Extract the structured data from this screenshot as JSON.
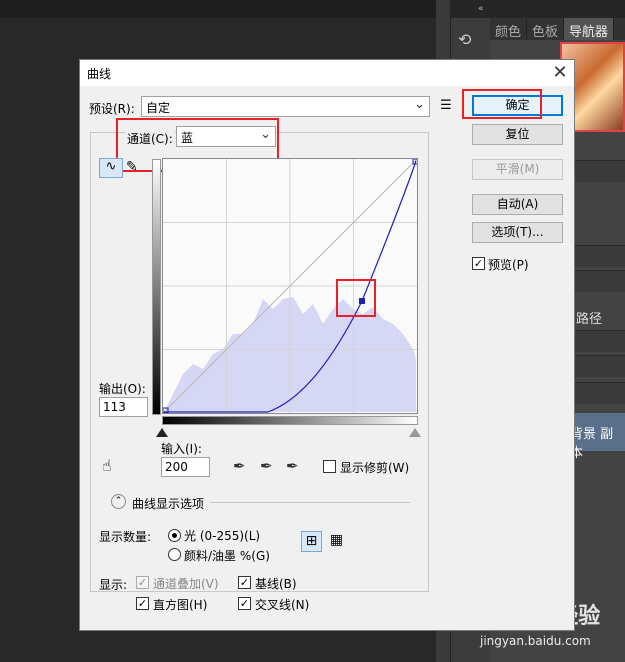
{
  "background_panels": {
    "tabs": [
      "颜色",
      "色板",
      "导航器"
    ],
    "paths_label": "路径",
    "layer_name": "背景 副本",
    "watermark": "Baidu 经验",
    "watermark_url": "jingyan.baidu.com",
    "collapse_arrows": "«"
  },
  "dialog": {
    "title": "曲线",
    "close": "✕",
    "preset_label": "预设(R):",
    "preset_value": "自定",
    "channel_label": "通道(C):",
    "channel_value": "蓝",
    "output_label": "输出(O):",
    "output_value": "113",
    "input_label": "输入(I):",
    "input_value": "200",
    "show_clipping_label": "显示修剪(W)",
    "curve_options_label": "曲线显示选项",
    "display_amount_label": "显示数量:",
    "light_option": "光 (0-255)(L)",
    "pigment_option": "颜料/油墨 %(G)",
    "show_label": "显示:",
    "channel_overlay": "通道叠加(V)",
    "baseline": "基线(B)",
    "histogram": "直方图(H)",
    "intersection": "交叉线(N)",
    "buttons": {
      "ok": "确定",
      "reset": "复位",
      "smooth": "平滑(M)",
      "auto": "自动(A)",
      "options": "选项(T)...",
      "preview": "预览(P)"
    },
    "checkbox_mark": "✓",
    "accent_color": "#0078d7",
    "highlight_color": "#e8202a",
    "curve_color": "#1f1fb8",
    "histogram_color": "#d6d6f5"
  }
}
